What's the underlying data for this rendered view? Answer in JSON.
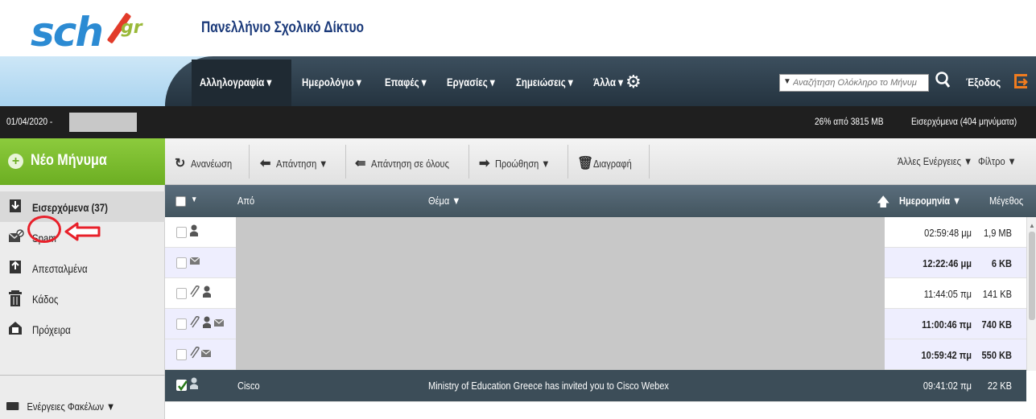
{
  "header": {
    "logo_text": "sch",
    "logo_suffix": "gr",
    "site_title": "Πανελλήνιο Σχολικό Δίκτυο"
  },
  "nav": {
    "items": [
      {
        "label": "Αλληλογραφία ▾"
      },
      {
        "label": "Ημερολόγιο ▾"
      },
      {
        "label": "Επαφές ▾"
      },
      {
        "label": "Εργασίες ▾"
      },
      {
        "label": "Σημειώσεις ▾"
      },
      {
        "label": "Άλλα ▾"
      }
    ],
    "settings_icon": "gear-icon",
    "search_placeholder": "Αναζήτηση Ολόκληρο το Μήνυμ",
    "logout_label": "Έξοδος",
    "accent_color": "#8cc63f"
  },
  "status": {
    "date": "01/04/2020 -",
    "quota": "26% από 3815 MB",
    "folder_count": "Εισερχόμενα (404 μηνύματα)"
  },
  "sidebar": {
    "new_message": "Νέο Μήνυμα",
    "folders": [
      {
        "label": "Εισερχόμενα (37)",
        "icon": "inbox-icon"
      },
      {
        "label": "Spam",
        "icon": "spam-icon"
      },
      {
        "label": "Απεσταλμένα",
        "icon": "sent-icon"
      },
      {
        "label": "Κάδος",
        "icon": "trash-icon"
      },
      {
        "label": "Πρόχειρα",
        "icon": "drafts-icon"
      }
    ],
    "folder_actions": "Ενέργειες Φακέλων ▼"
  },
  "toolbar": {
    "refresh": "Ανανέωση",
    "reply": "Απάντηση ▼",
    "reply_all": "Απάντηση σε όλους",
    "forward": "Προώθηση ▼",
    "delete": "Διαγραφή",
    "more_actions": "Άλλες Ενέργειες ▼",
    "filter": "Φίλτρο ▼"
  },
  "table": {
    "columns": {
      "from": "Από",
      "subject": "Θέμα ▼",
      "date": "Ημερομηνία ▼",
      "size": "Μέγεθος"
    },
    "rows": [
      {
        "icons": "👤",
        "time": "02:59:48 μμ",
        "size": "1,9 MB",
        "unread": false
      },
      {
        "icons": "✉",
        "time": "12:22:46 μμ",
        "size": "6 KB",
        "unread": true
      },
      {
        "icons": "📎👤",
        "time": "11:44:05 πμ",
        "size": "141 KB",
        "unread": false
      },
      {
        "icons": "📎👤✉",
        "time": "11:00:46 πμ",
        "size": "740 KB",
        "unread": true
      },
      {
        "icons": "📎✉",
        "time": "10:59:42 πμ",
        "size": "550 KB",
        "unread": true
      },
      {
        "icons": "👤",
        "from": "Cisco",
        "subject": "Ministry of Education Greece has invited you to Cisco Webex",
        "time": "09:41:02 πμ",
        "size": "22 KB",
        "selected": true
      }
    ]
  },
  "colors": {
    "annotation_red": "#e8202a",
    "header_dark": "#2c3b47",
    "new_message_green": "#7cbc2e"
  }
}
